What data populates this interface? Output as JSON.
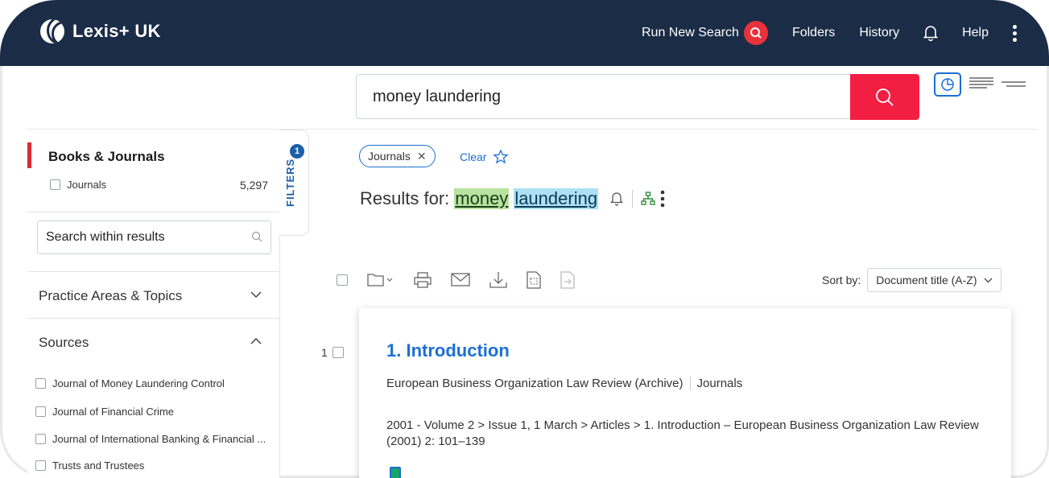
{
  "app": {
    "brand": "Lexis+ UK"
  },
  "nav": {
    "run_new_search": "Run New Search",
    "folders": "Folders",
    "history": "History",
    "help": "Help"
  },
  "search": {
    "value": "money laundering"
  },
  "left": {
    "category_title": "Books & Journals",
    "category_item": {
      "label": "Journals",
      "count": "5,297"
    },
    "within_placeholder": "Search within results",
    "practice_areas": "Practice Areas & Topics",
    "sources": "Sources",
    "source_items": [
      "Journal of Money Laundering Control",
      "Journal of Financial Crime",
      "Journal of International Banking & Financial ...",
      "Trusts and Trustees"
    ]
  },
  "filters_tab": {
    "label": "FILTERS",
    "count": "1"
  },
  "main": {
    "chip": "Journals",
    "clear": "Clear",
    "results_prefix": "Results for:",
    "term1": "money",
    "term2": "laundering",
    "sort_label": "Sort by:",
    "sort_value": "Document title (A-Z)"
  },
  "result": {
    "number": "1",
    "title": "1. Introduction",
    "source": "European Business Organization Law Review (Archive)",
    "type": "Journals",
    "path": "2001 - Volume 2 > Issue 1, 1 March > Articles > 1. Introduction – European Business Organization Law Review (2001) 2: 101–139"
  },
  "colors": {
    "topbar": "#1b2c47",
    "accent_red": "#f21f43",
    "link_blue": "#1b6fd6"
  }
}
